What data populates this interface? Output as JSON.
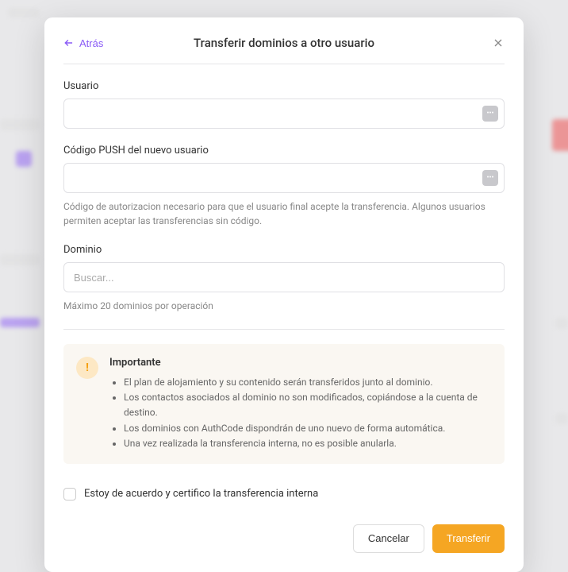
{
  "header": {
    "back_label": "Atrás",
    "title": "Transferir dominios a otro usuario"
  },
  "fields": {
    "user": {
      "label": "Usuario",
      "value": ""
    },
    "push_code": {
      "label": "Código PUSH del nuevo usuario",
      "value": "",
      "helper": "Código de autorizacion necesario para que el usuario final acepte la transferencia. Algunos usuarios permiten aceptar las transferencias sin código."
    },
    "domain": {
      "label": "Dominio",
      "placeholder": "Buscar...",
      "helper": "Máximo 20 dominios por operación"
    }
  },
  "alert": {
    "title": "Importante",
    "items": [
      "El plan de alojamiento y su contenido serán transferidos junto al dominio.",
      "Los contactos asociados al dominio no son modificados, copiándose a la cuenta de destino.",
      "Los dominios con AuthCode dispondrán de uno nuevo de forma automática.",
      "Una vez realizada la transferencia interna, no es posible anularla."
    ]
  },
  "confirm": {
    "label": "Estoy de acuerdo y certifico la transferencia interna"
  },
  "footer": {
    "cancel": "Cancelar",
    "submit": "Transferir"
  }
}
